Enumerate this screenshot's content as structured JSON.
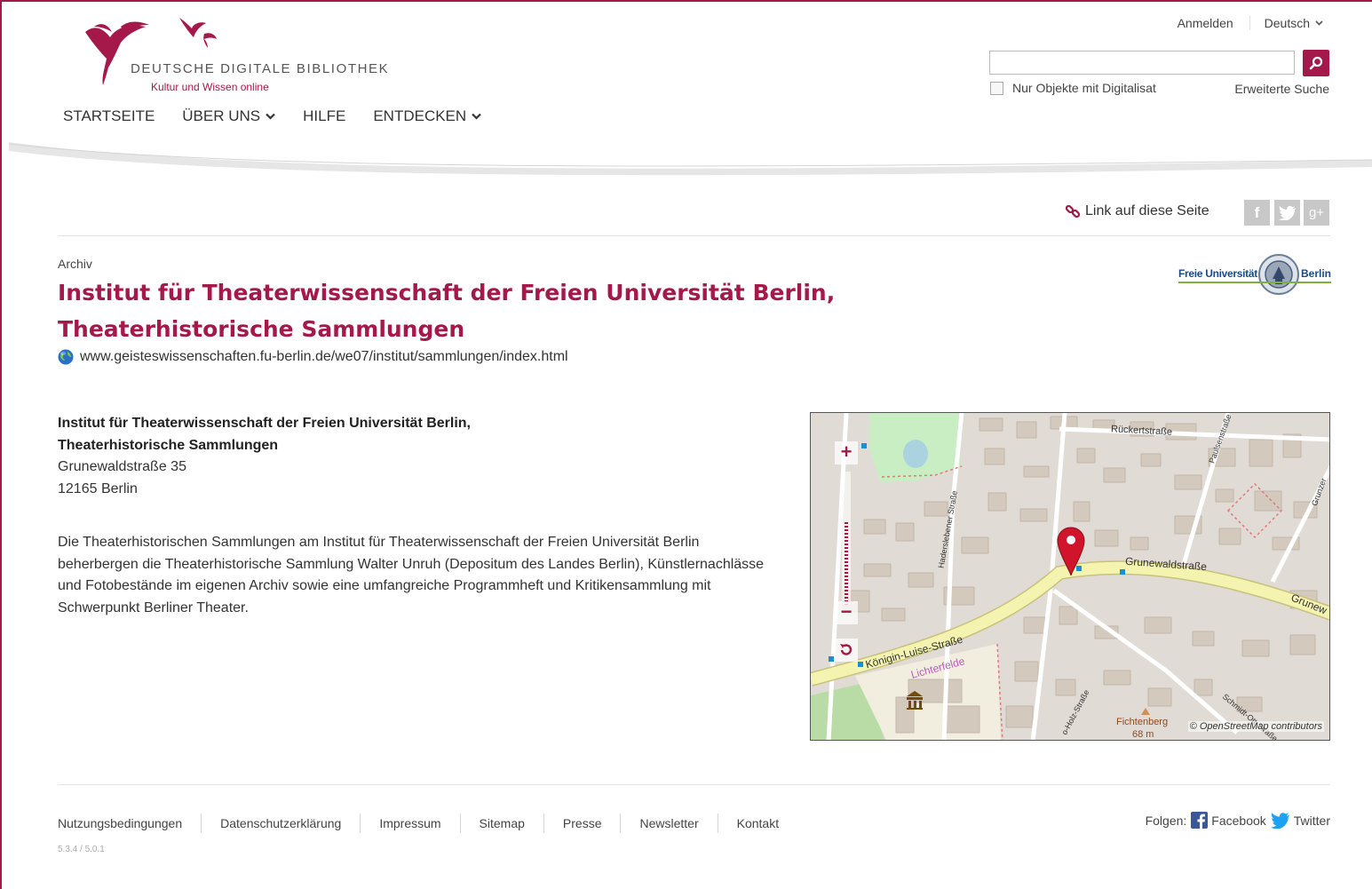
{
  "header": {
    "logo_title": "DEUTSCHE DIGITALE BIBLIOTHEK",
    "logo_subtitle": "Kultur und Wissen online",
    "login": "Anmelden",
    "language": "Deutsch",
    "search": {
      "value": "",
      "placeholder": ""
    },
    "digitized_only_label": "Nur Objekte mit Digitalisat",
    "advanced_search": "Erweiterte Suche",
    "nav": [
      "STARTSEITE",
      "ÜBER UNS",
      "HILFE",
      "ENTDECKEN"
    ]
  },
  "share": {
    "link_label": "Link auf diese Seite",
    "social": [
      "f",
      "t",
      "g+"
    ]
  },
  "main": {
    "category": "Archiv",
    "title": "Institut für Theaterwissenschaft der Freien Universität Berlin, Theaterhistorische Sammlungen",
    "url": "www.geisteswissenschaften.fu-berlin.de/we07/institut/sammlungen/index.html",
    "partner_logo": {
      "left": "Freie Universität",
      "right": "Berlin"
    },
    "address": {
      "org_line1": "Institut für Theaterwissenschaft der Freien Universität Berlin,",
      "org_line2": "Theaterhistorische Sammlungen",
      "street": "Grunewaldstraße 35",
      "city": "12165 Berlin"
    },
    "description": "Die Theaterhistorischen Sammlungen am Institut für Theaterwissenschaft der Freien Universität Berlin beherbergen die Theaterhistorische Sammlung Walter Unruh (Depositum des Landes Berlin), Künstlernachlässe und Fotobestände im eigenen Archiv sowie eine umfangreiche Programmheft und Kritikensammlung mit Schwerpunkt Berliner Theater."
  },
  "map": {
    "streets": {
      "rueckert": "Rückertstraße",
      "grunewald": "Grunewaldstraße",
      "grunew_edge": "Grunew",
      "koenigin_luise": "Königin-Luise-Straße",
      "haderslebener": "Haderslebener Straße",
      "paulsen": "Paulsenstraße",
      "grunz": "Grunzer",
      "holz": "o-Holz-Straße",
      "schmidt": "Schmidt-Ott-Straße"
    },
    "district": "Lichterfelde",
    "peak_name": "Fichtenberg",
    "peak_height": "68 m",
    "attribution": "© OpenStreetMap contributors",
    "zoom_in": "+",
    "zoom_out": "−",
    "zoom_level_fraction": 0.62
  },
  "footer": {
    "links": [
      "Nutzungsbedingungen",
      "Datenschutzerklärung",
      "Impressum",
      "Sitemap",
      "Presse",
      "Newsletter",
      "Kontakt"
    ],
    "follow_label": "Folgen:",
    "facebook": "Facebook",
    "twitter": "Twitter",
    "version": "5.3.4 / 5.0.1"
  },
  "colors": {
    "brand": "#a5194a",
    "map_road": "#f5f3b0",
    "map_marker": "#d0142c"
  }
}
